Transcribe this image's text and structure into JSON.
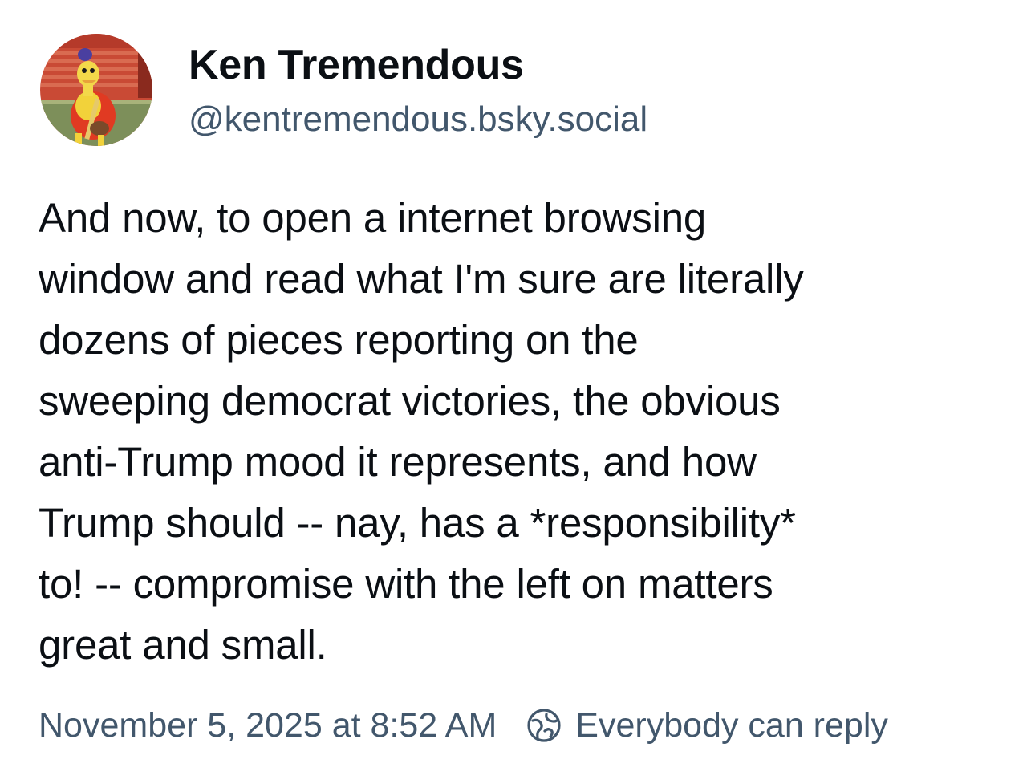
{
  "author": {
    "display_name": "Ken Tremendous",
    "handle": "@kentremendous.bsky.social",
    "avatar_icon": "mascot-avatar"
  },
  "post": {
    "text_lines": [
      "And now, to open a internet browsing",
      "window and read what I'm sure are literally",
      "dozens of pieces reporting on the",
      "sweeping democrat victories, the obvious",
      "anti-Trump mood it represents, and how",
      "Trump should -- nay, has a *responsibility*",
      "to! -- compromise with the left on matters",
      "great and small."
    ]
  },
  "meta": {
    "timestamp": "November 5, 2025 at 8:52 AM",
    "reply_setting": "Everybody can reply",
    "reply_icon": "globe-icon"
  },
  "colors": {
    "text": "#0b0f14",
    "secondary": "#42576c",
    "background": "#ffffff"
  }
}
